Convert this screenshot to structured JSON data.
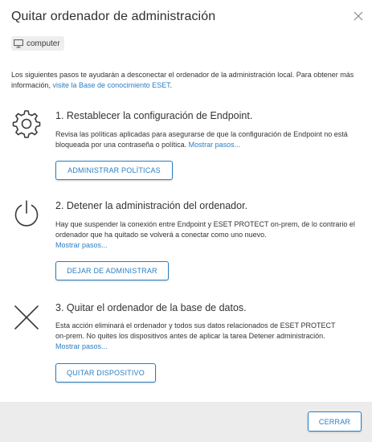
{
  "dialog": {
    "title": "Quitar ordenador de administración",
    "close_icon": "close-icon"
  },
  "tag": {
    "icon": "monitor-icon",
    "label": "computer"
  },
  "intro": {
    "text": "Los siguientes pasos te ayudarán a desconectar el ordenador de la administración local. Para obtener más información, ",
    "link": "visite la Base de conocimiento ESET",
    "after": "."
  },
  "steps": [
    {
      "icon": "gear-icon",
      "heading": "1. Restablecer la configuración de Endpoint.",
      "description": "Revisa las políticas aplicadas para asegurarse de que la configuración de Endpoint no está bloqueada por una contraseña o política. ",
      "link": "Mostrar pasos...",
      "button": "ADMINISTRAR POLÍTICAS"
    },
    {
      "icon": "power-icon",
      "heading": "2. Detener la administración del ordenador.",
      "description": "Hay que suspender la conexión entre Endpoint y ESET PROTECT on-prem, de lo contrario el ordenador que ha quitado se volverá a conectar como uno nuevo.",
      "link": "Mostrar pasos...",
      "button": "DEJAR DE ADMINISTRAR"
    },
    {
      "icon": "x-icon",
      "heading": "3. Quitar el ordenador de la base de datos.",
      "description": "Esta acción eliminará el ordenador y todos sus datos relacionados de ESET PROTECT on-prem. No quites los dispositivos antes de aplicar la tarea Detener administración. ",
      "link": "Mostrar pasos...",
      "button": "QUITAR DISPOSITIVO"
    }
  ],
  "footer": {
    "close_button": "CERRAR"
  },
  "colors": {
    "accent": "#2a7ec3",
    "footer_bg": "#ececec",
    "text": "#333333"
  }
}
